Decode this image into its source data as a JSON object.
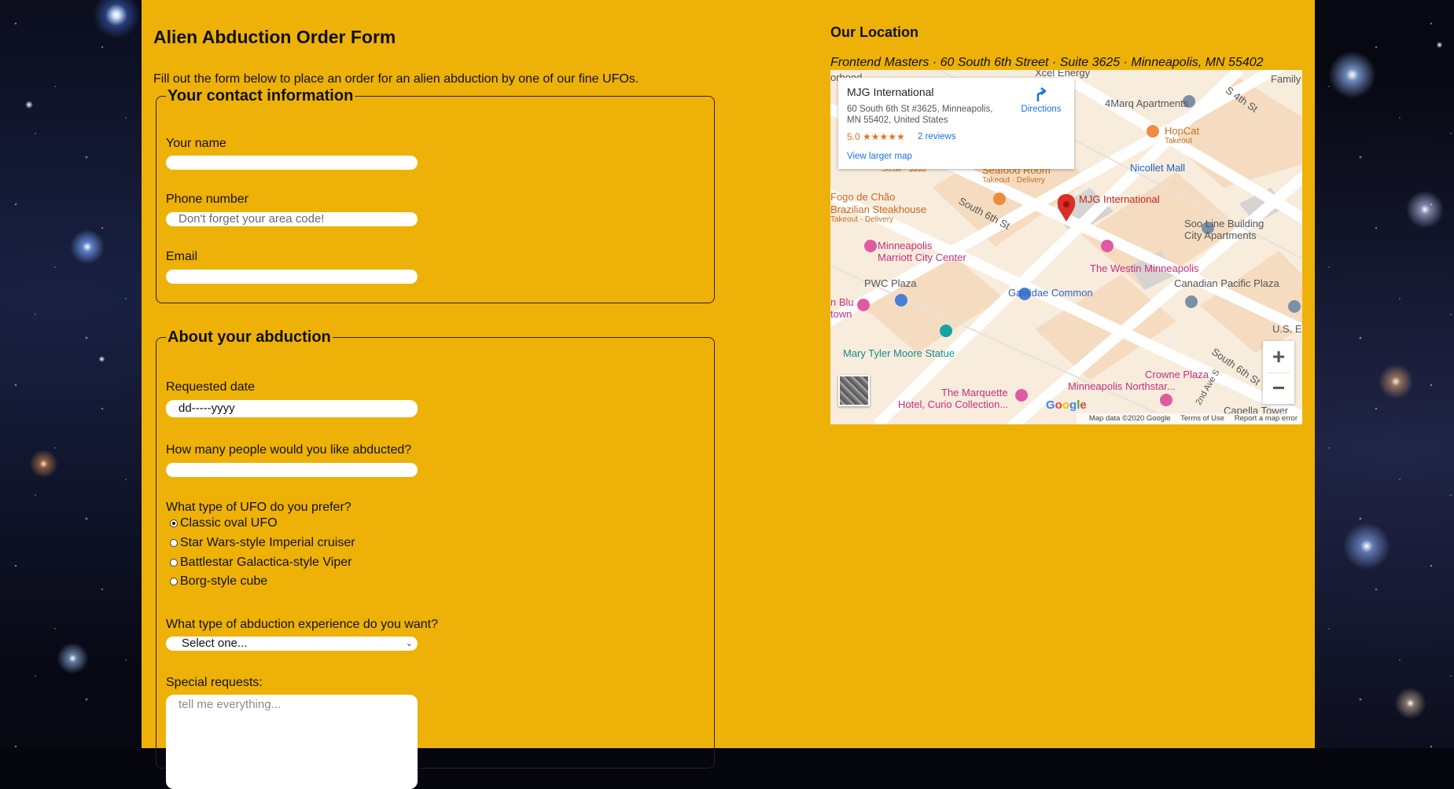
{
  "form": {
    "title": "Alien Abduction Order Form",
    "intro": "Fill out the form below to place an order for an alien abduction by one of our fine UFOs.",
    "contact": {
      "legend": "Your contact information",
      "name_label": "Your name",
      "name_value": "",
      "phone_label": "Phone number",
      "phone_placeholder": "Don't forget your area code!",
      "email_label": "Email",
      "email_value": ""
    },
    "abduction": {
      "legend": "About your abduction",
      "date_label": "Requested date",
      "date_value": "dd-----yyyy",
      "people_label": "How many people would you like abducted?",
      "people_value": "",
      "ufo_label": "What type of UFO do you prefer?",
      "ufo_options": [
        {
          "label": "Classic oval UFO",
          "selected": true
        },
        {
          "label": "Star Wars-style Imperial cruiser",
          "selected": false
        },
        {
          "label": "Battlestar Galactica-style Viper",
          "selected": false
        },
        {
          "label": "Borg-style cube",
          "selected": false
        }
      ],
      "experience_label": "What type of abduction experience do you want?",
      "experience_value": "Select one...",
      "requests_label": "Special requests:",
      "requests_placeholder": "tell me everything..."
    }
  },
  "location": {
    "title": "Our Location",
    "address": "Frontend Masters · 60 South 6th Street · Suite 3625 · Minneapolis, MN 55402",
    "map": {
      "place_name": "MJG International",
      "place_address": "60 South 6th St #3625, Minneapolis, MN 55402, United States",
      "rating": "5.0 ★★★★★",
      "reviews": "2 reviews",
      "directions": "Directions",
      "larger_map": "View larger map",
      "zoom_in": "+",
      "zoom_out": "−",
      "google": "Google",
      "map_data": "Map data ©2020 Google",
      "terms": "Terms of Use",
      "report": "Report a map error",
      "labels": {
        "marker": "MJG International",
        "nicollet": "Nicollet Mall",
        "apartments4": "4Marq Apartments",
        "s4th": "S 4th St",
        "hopcat": "HopCat",
        "hopcat_sub": "Takeout",
        "seafood": "Seafood Room",
        "seafood_sub": "Takeout · Delivery",
        "fogo": "Fogo de Chão",
        "fogo2": "Brazilian Steakhouse",
        "fogo_sub": "Takeout · Delivery",
        "south6th": "South 6th St",
        "soo": "Soo Line Building",
        "soo2": "City Apartments",
        "marriott": "Minneapolis",
        "marriott2": "Marriott City Center",
        "westin": "The Westin Minneapolis",
        "canadian": "Canadian Pacific Plaza",
        "pwc": "PWC Plaza",
        "gaviidae": "Gaviidae Common",
        "blu": "n Blu",
        "blu2": "town",
        "mary": "Mary Tyler Moore Statue",
        "crowne": "Crowne Plaza",
        "northstar": "Minneapolis Northstar...",
        "marquette": "The Marquette",
        "marquette2": "Hotel, Curio Collection...",
        "capella": "Capella Tower",
        "south6th_b": "South 6th St",
        "ave": "2nd Ave S",
        "us": "U.S. E",
        "xcel": "Xcel Energy",
        "family": "Family",
        "orhood": "orhood",
        "steak": "Steak · $$$$"
      }
    }
  }
}
